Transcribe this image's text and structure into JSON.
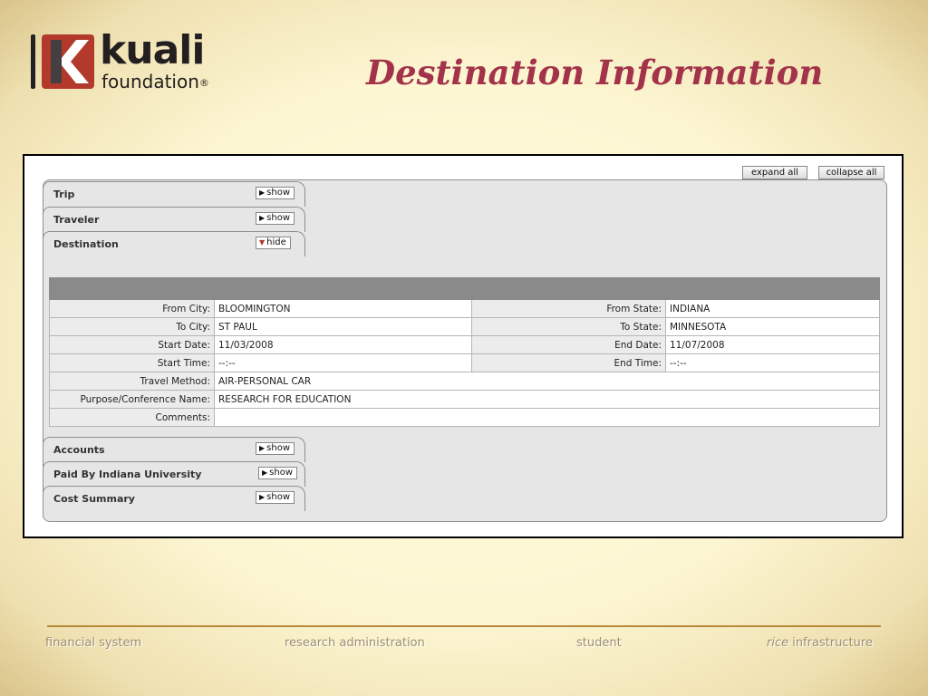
{
  "slide": {
    "title": "Destination Information"
  },
  "logo": {
    "word1": "kuali",
    "word2": "foundation",
    "reg": "®"
  },
  "toolbar": {
    "expand_all": "expand all",
    "collapse_all": "collapse all"
  },
  "sections": [
    {
      "label": "Trip",
      "toggle": "show"
    },
    {
      "label": "Traveler",
      "toggle": "show"
    },
    {
      "label": "Destination",
      "toggle": "hide"
    },
    {
      "label": "Accounts",
      "toggle": "show"
    },
    {
      "label": "Paid By Indiana University",
      "toggle": "show"
    },
    {
      "label": "Cost Summary",
      "toggle": "show"
    }
  ],
  "destination": {
    "from_city_label": "From City:",
    "from_city": "BLOOMINGTON",
    "from_state_label": "From State:",
    "from_state": "INDIANA",
    "to_city_label": "To City:",
    "to_city": "ST PAUL",
    "to_state_label": "To State:",
    "to_state": "MINNESOTA",
    "start_date_label": "Start Date:",
    "start_date": "11/03/2008",
    "end_date_label": "End Date:",
    "end_date": "11/07/2008",
    "start_time_label": "Start Time:",
    "start_time": "--:--",
    "end_time_label": "End Time:",
    "end_time": "--:--",
    "travel_method_label": "Travel Method:",
    "travel_method": "AIR-PERSONAL CAR",
    "purpose_label": "Purpose/Conference Name:",
    "purpose": "RESEARCH FOR EDUCATION",
    "comments_label": "Comments:",
    "comments": ""
  },
  "footer": {
    "item1": "financial system",
    "item2": "research administration",
    "item3": "student",
    "item4_em": "rice",
    "item4_rest": " infrastructure"
  },
  "colors": {
    "title": "#a3334a",
    "logo_red": "#b2392b",
    "footer_line": "#b8893a"
  }
}
